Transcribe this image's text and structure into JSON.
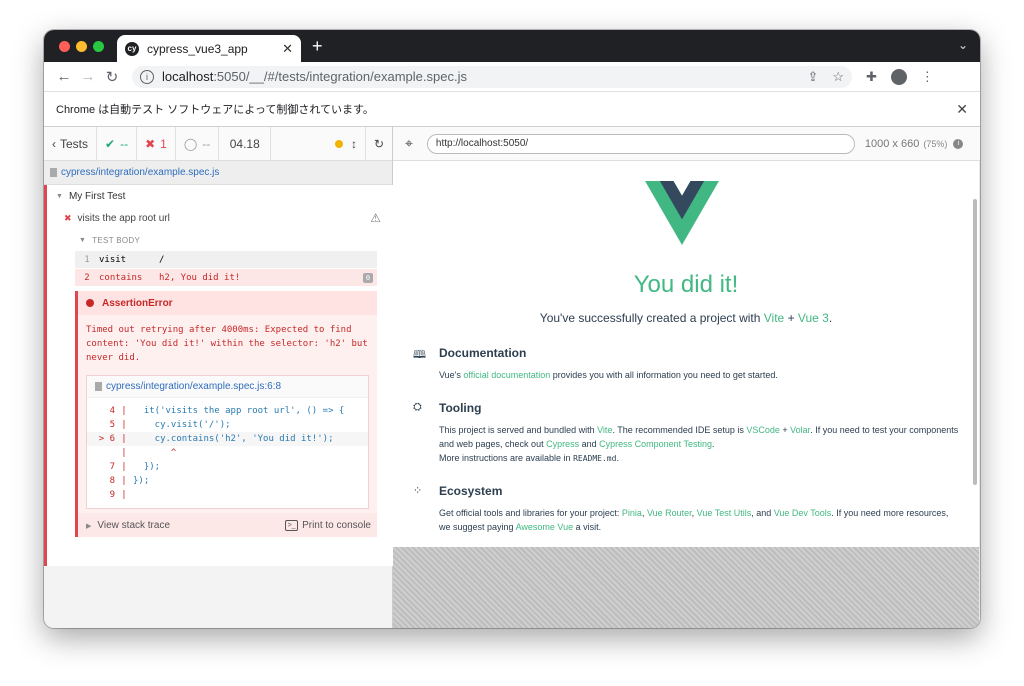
{
  "browser": {
    "tab_title": "cypress_vue3_app",
    "tab_favicon": "cy",
    "url_host": "localhost",
    "url_path": ":5050/__/#/tests/integration/example.spec.js",
    "infobar": "Chrome は自動テスト ソフトウェアによって制御されています。"
  },
  "reporter": {
    "tests_label": "Tests",
    "passed": "--",
    "failed": "1",
    "pending": "--",
    "duration": "04.18",
    "spec_path": "cypress/integration/example.spec.js",
    "suite": "My First Test",
    "test": "visits the app root url",
    "test_body": "TEST BODY",
    "commands": [
      {
        "num": "1",
        "name": "visit",
        "msg": "/"
      },
      {
        "num": "2",
        "name": "contains",
        "msg": "h2, You did it!",
        "badge": "0"
      }
    ],
    "error": {
      "name": "AssertionError",
      "message": "Timed out retrying after 4000ms: Expected to find content: 'You did it!' within the selector: 'h2' but never did.",
      "frame_file": "cypress/integration/example.spec.js:6:8",
      "code": [
        {
          "num": "4",
          "bar": "|",
          "code": "  it('visits the app root url', () => {"
        },
        {
          "num": "5",
          "bar": "|",
          "code": "    cy.visit('/');"
        },
        {
          "num": "> 6",
          "bar": "|",
          "code": "    cy.contains('h2', 'You did it!');"
        },
        {
          "num": "",
          "bar": "|",
          "code": "       ^"
        },
        {
          "num": "7",
          "bar": "|",
          "code": "  });"
        },
        {
          "num": "8",
          "bar": "|",
          "code": "});"
        },
        {
          "num": "9",
          "bar": "|",
          "code": ""
        }
      ],
      "view_stack": "View stack trace",
      "print": "Print to console"
    }
  },
  "aut": {
    "url": "http://localhost:5050/",
    "viewport": "1000 x 660",
    "scale": "(75%)"
  },
  "app": {
    "headline": "You did it!",
    "subtitle_pre": "You've successfully created a project with ",
    "subtitle_vite": "Vite",
    "subtitle_plus": " + ",
    "subtitle_vue": "Vue 3",
    "subtitle_end": ".",
    "sections": {
      "doc_title": "Documentation",
      "doc_pre": "Vue's ",
      "doc_link": "official documentation",
      "doc_post": " provides you with all information you need to get started.",
      "tool_title": "Tooling",
      "tool_1": "This project is served and bundled with ",
      "tool_vite": "Vite",
      "tool_2": ". The recommended IDE setup is ",
      "tool_vscode": "VSCode",
      "tool_3": " + ",
      "tool_volar": "Volar",
      "tool_4": ". If you need to test your components and web pages, check out ",
      "tool_cypress": "Cypress",
      "tool_5": " and ",
      "tool_cct": "Cypress Component Testing",
      "tool_6": ".",
      "tool_more": "More instructions are available in ",
      "tool_readme": "README.md",
      "tool_dot": ".",
      "eco_title": "Ecosystem",
      "eco_1": "Get official tools and libraries for your project: ",
      "eco_pinia": "Pinia",
      "eco_c1": ", ",
      "eco_router": "Vue Router",
      "eco_c2": ", ",
      "eco_vtu": "Vue Test Utils",
      "eco_and": ", and ",
      "eco_devtools": "Vue Dev Tools",
      "eco_2": ". If you need more resources, we suggest paying ",
      "eco_awesome": "Awesome Vue",
      "eco_3": " a visit."
    }
  },
  "colors": {
    "vue_green": "#42b883",
    "vue_dark": "#35495e",
    "fail": "#e0464f",
    "pass": "#1fa971"
  }
}
